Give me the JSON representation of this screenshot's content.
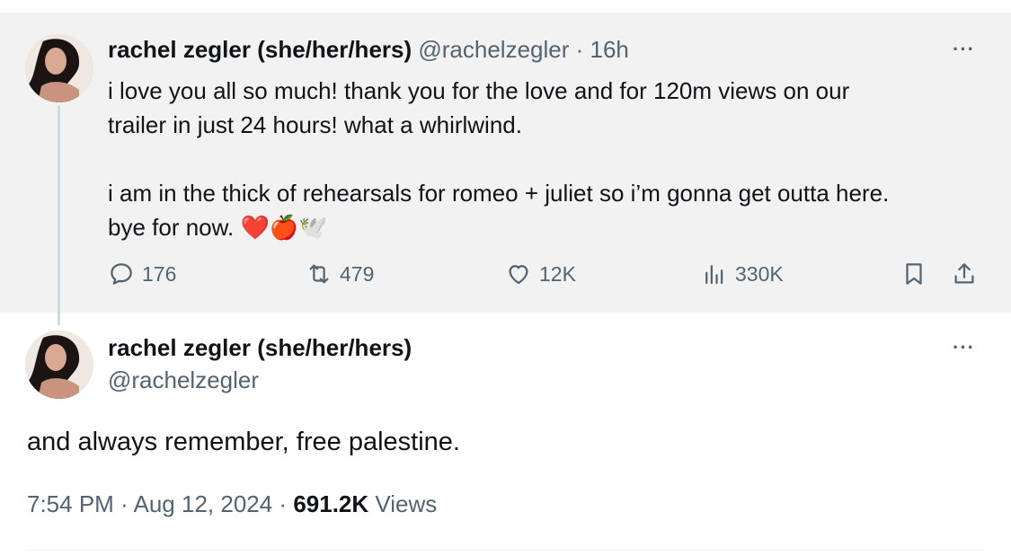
{
  "tweet1": {
    "display_name": "rachel zegler (she/her/hers)",
    "handle": "@rachelzegler",
    "separator": " · ",
    "time": "16h",
    "line1": "i love you all so much! thank you for the love and for 120m views on our",
    "line2": "trailer in just 24 hours! what a whirlwind.",
    "line3": "i am in the thick of rehearsals for romeo + juliet so i’m gonna get outta here.",
    "line4": "bye for now.",
    "emojis": [
      "❤️",
      "🍎",
      "🕊️"
    ],
    "more_label": "···",
    "stats": {
      "replies": "176",
      "reposts": "479",
      "likes": "12K",
      "views": "330K"
    }
  },
  "tweet2": {
    "display_name": "rachel zegler (she/her/hers)",
    "handle": "@rachelzegler",
    "more_label": "···",
    "text": "and always remember, free palestine.",
    "time": "7:54 PM",
    "separator1": " · ",
    "date": "Aug 12, 2024",
    "separator2": " · ",
    "views_count": "691.2K",
    "views_label": " Views"
  },
  "colors": {
    "highlight_bg": "#f2f2f2",
    "muted_text": "#536471",
    "heart": "#e0245e",
    "thread_line": "#cfd9de"
  },
  "icons": [
    "reply-icon",
    "repost-icon",
    "like-icon",
    "views-icon",
    "bookmark-icon",
    "share-icon",
    "more-icon"
  ]
}
